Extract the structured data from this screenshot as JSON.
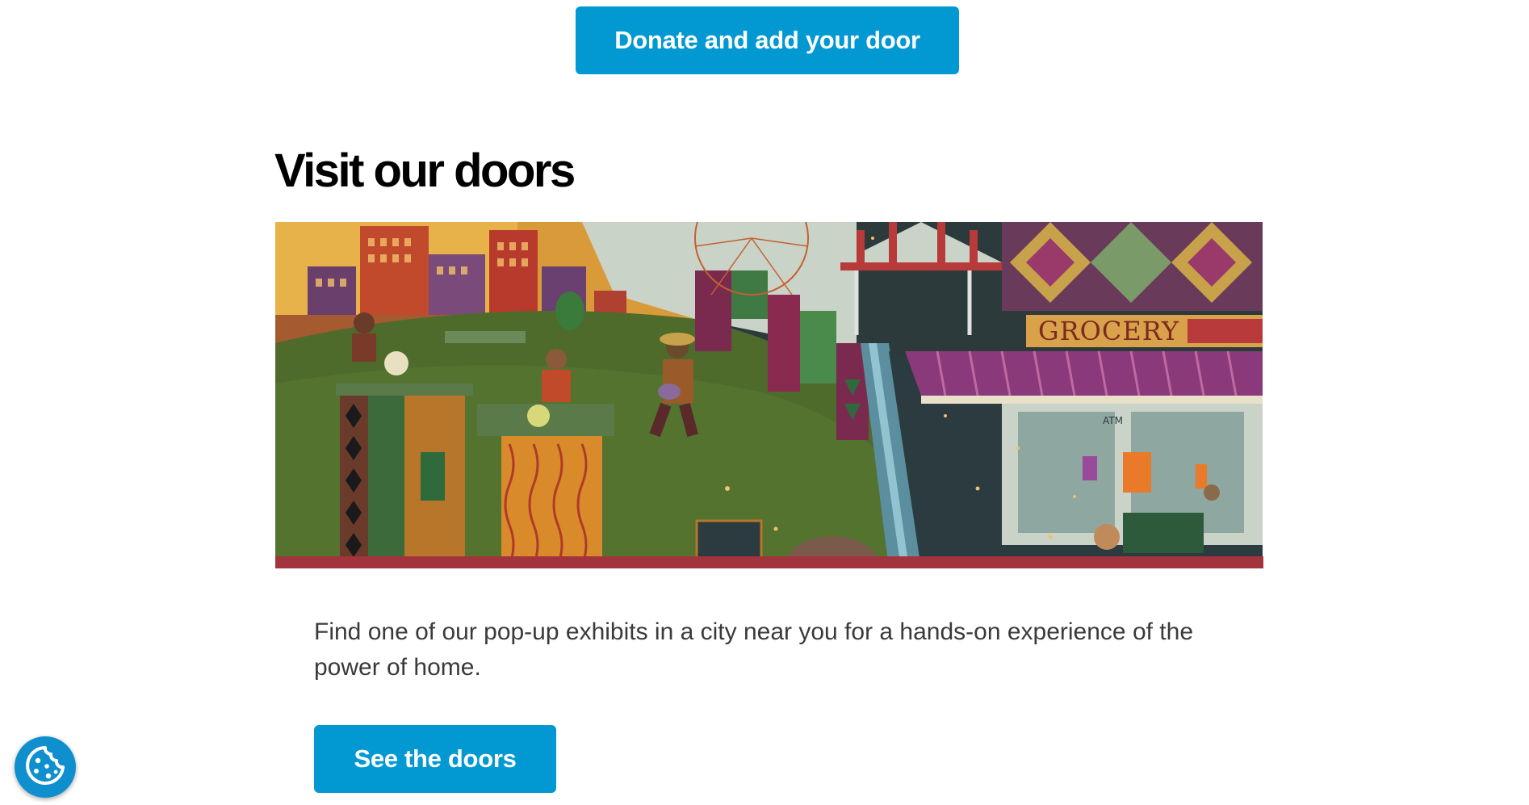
{
  "top_cta": {
    "label": "Donate and add your door"
  },
  "section": {
    "title": "Visit our doors",
    "description": "Find one of our pop-up exhibits in a city near you for a hands-on experience of the power of home.",
    "cta_label": "See the doors"
  },
  "hero": {
    "image_subject": "illustrated-city-scene",
    "sign_text": "GROCERY",
    "atm_text": "ATM"
  },
  "cookie_widget": {
    "icon": "cookie-icon"
  },
  "colors": {
    "accent": "#0299d2",
    "hero_bar": "#a3343e",
    "text": "#3a3a3a"
  }
}
